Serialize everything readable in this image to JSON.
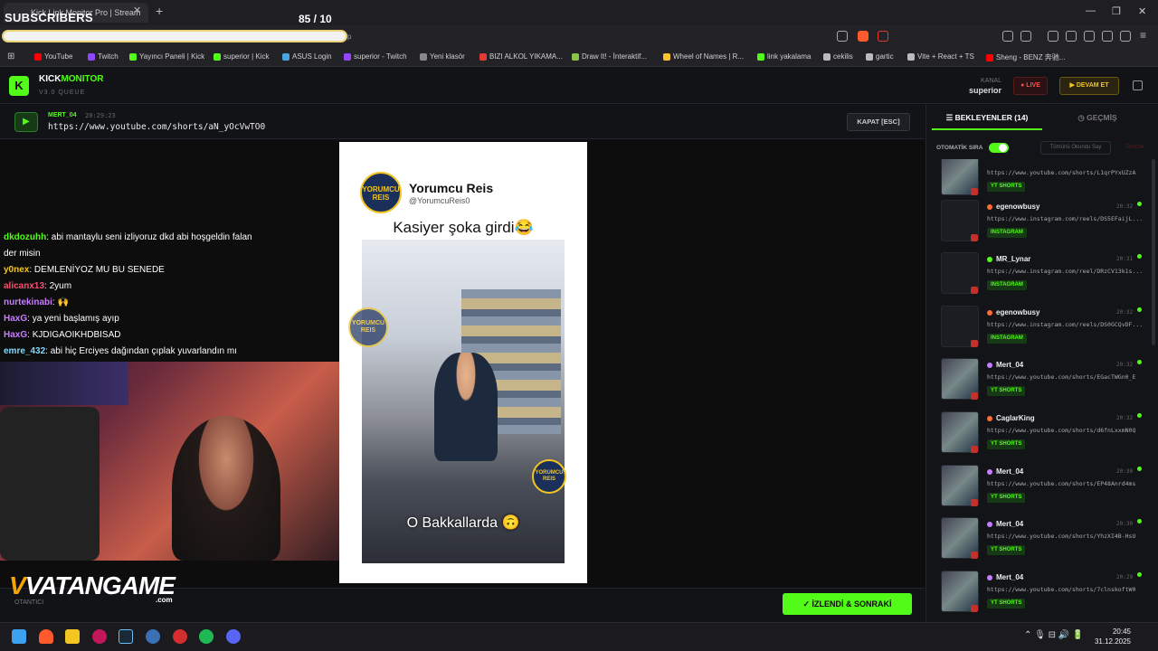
{
  "browser": {
    "tab_title": "Kick Link Monitor Pro | Stream",
    "tab_close": "✕",
    "new_tab": "+",
    "overlay_subscribers": "SUBSCRIBERS",
    "overlay_counter": "85  / 10",
    "address_tail": "p",
    "window_controls": [
      "—",
      "❐",
      "✕"
    ],
    "bookmarks": [
      {
        "label": "YouTube",
        "color": "#ff0000"
      },
      {
        "label": "Twitch",
        "color": "#9146ff"
      },
      {
        "label": "Yayıncı Paneli | Kick",
        "color": "#53fc18"
      },
      {
        "label": "superior | Kick",
        "color": "#53fc18"
      },
      {
        "label": "ASUS Login",
        "color": "#4aa3df"
      },
      {
        "label": "superior - Twitch",
        "color": "#9146ff"
      },
      {
        "label": "Yeni klasör",
        "color": "#888888"
      },
      {
        "label": "BIZI ALKOL YIKAMA...",
        "color": "#e53935"
      },
      {
        "label": "Draw It! - İnteraktif...",
        "color": "#8bc34a"
      },
      {
        "label": "Wheel of Names | R...",
        "color": "#fbc02d"
      },
      {
        "label": "link yakalama",
        "color": "#53fc18"
      },
      {
        "label": "cekilis",
        "color": "#bbbbbb"
      },
      {
        "label": "gartic",
        "color": "#bbbbbb"
      },
      {
        "label": "Vite + React + TS",
        "color": "#bbbbbb"
      },
      {
        "label": "Sheng - BENZ 奔驰...",
        "color": "#ff0000"
      }
    ]
  },
  "header": {
    "logo_letter": "K",
    "brand_kick": "KICK",
    "brand_monitor": "MONITOR",
    "version": "V3.0 QUEUE",
    "kanal_label": "KANAL",
    "kanal_value": "superior",
    "live_label": "● LIVE",
    "devam_label": "▶ DEVAM ET"
  },
  "now_playing": {
    "user": "MERT_04",
    "time": "20:29:23",
    "url": "https://www.youtube.com/shorts/aN_yOcVwTO0",
    "close_label": "KAPAT [ESC]"
  },
  "chat": [
    {
      "user": "dkdozuhh",
      "text": "abi mantaylu seni izliyoruz dkd abi hoşgeldin falan",
      "color": "#53fc18"
    },
    {
      "user": "",
      "text": "der misin",
      "color": "#ffffff"
    },
    {
      "user": "y0nex",
      "text": "DEMLENİYOZ MU BU SENEDE",
      "color": "#f2c521"
    },
    {
      "user": "alicanx13",
      "text": "2yum",
      "color": "#ff4d6d"
    },
    {
      "user": "nurtekinabi",
      "text": "🙌",
      "color": "#c77dff"
    },
    {
      "user": "HaxG",
      "text": "ya yeni başlamış ayıp",
      "color": "#c77dff"
    },
    {
      "user": "HaxG",
      "text": "KJDIGAOIKHDBISAD",
      "color": "#c77dff"
    },
    {
      "user": "emre_432",
      "text": "abi hiç Erciyes dağından çıplak yuvarlandın mı",
      "color": "#7fdbff"
    }
  ],
  "short": {
    "channel_name": "Yorumcu Reis",
    "channel_handle": "@YorumcuReis0",
    "avatar_text": "YORUMCU REIS",
    "caption": "Kasiyer şoka girdi😂",
    "subtitle": "O Bakkallarda 🙃"
  },
  "bottom": {
    "sponsor": "VATANGAME",
    "sponsor_v": "V",
    "sponsor_suffix": ".com",
    "label": "OTANTICI",
    "next_button": "İZLENDİ & SONRAKİ"
  },
  "panel": {
    "queue_tab": "BEKLEYENLER (14)",
    "history_tab": "GEÇMİŞ",
    "auto_label": "OTOMATİK SIRA",
    "mark_all": "Tümünü Okundu Say",
    "clear_all": "Temizle",
    "items": [
      {
        "user": "",
        "time": "",
        "url": "https://www.youtube.com/shorts/L1qrPYxUZzA",
        "tag": "YT SHORTS",
        "dot": "#53fc18",
        "thumb": true
      },
      {
        "user": "egenowbusy",
        "time": "20:32",
        "url": "https://www.instagram.com/reels/DS5EFaijL...",
        "tag": "INSTAGRAM",
        "dot": "#ff6b35",
        "thumb": false
      },
      {
        "user": "MR_Lynar",
        "time": "20:31",
        "url": "https://www.instagram.com/reel/DRzCV13k1s...",
        "tag": "INSTAGRAM",
        "dot": "#53fc18",
        "thumb": false
      },
      {
        "user": "egenowbusy",
        "time": "20:32",
        "url": "https://www.instagram.com/reels/DS0GCQvDF...",
        "tag": "INSTAGRAM",
        "dot": "#ff6b35",
        "thumb": false
      },
      {
        "user": "Mert_04",
        "time": "20:32",
        "url": "https://www.youtube.com/shorts/EGacTWGn0_E",
        "tag": "YT SHORTS",
        "dot": "#c77dff",
        "thumb": true
      },
      {
        "user": "CaglarKing",
        "time": "20:32",
        "url": "https://www.youtube.com/shorts/d6fnLxxmN0Q",
        "tag": "YT SHORTS",
        "dot": "#ff6b35",
        "thumb": true
      },
      {
        "user": "Mert_04",
        "time": "20:30",
        "url": "https://www.youtube.com/shorts/EP48Anrd4ms",
        "tag": "YT SHORTS",
        "dot": "#c77dff",
        "thumb": true
      },
      {
        "user": "Mert_04",
        "time": "20:30",
        "url": "https://www.youtube.com/shorts/YhzXI4B-HsU",
        "tag": "YT SHORTS",
        "dot": "#c77dff",
        "thumb": true
      },
      {
        "user": "Mert_04",
        "time": "20:29",
        "url": "https://www.youtube.com/shorts/7clnskoftW0",
        "tag": "YT SHORTS",
        "dot": "#c77dff",
        "thumb": true
      }
    ]
  },
  "taskbar": {
    "time": "20:45",
    "date": "31.12.2025",
    "tray": "⌃  🎙  ⊟  🔊  🔋"
  }
}
